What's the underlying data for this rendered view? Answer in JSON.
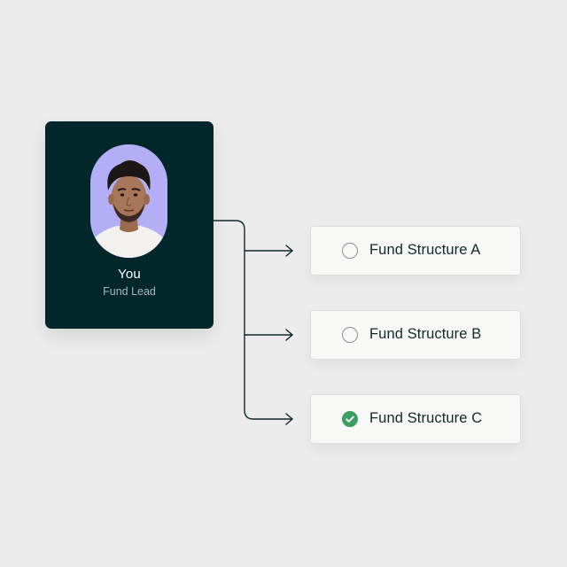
{
  "profile": {
    "name": "You",
    "role": "Fund Lead",
    "avatar_icon": "person-portrait",
    "card_color": "#02272a",
    "avatar_bg": "#b4aef7"
  },
  "options": [
    {
      "label": "Fund Structure A",
      "selected": false
    },
    {
      "label": "Fund Structure B",
      "selected": false
    },
    {
      "label": "Fund Structure C",
      "selected": true
    }
  ],
  "colors": {
    "background": "#ececec",
    "connector": "#0f2a2a",
    "check": "#3c9e63"
  }
}
